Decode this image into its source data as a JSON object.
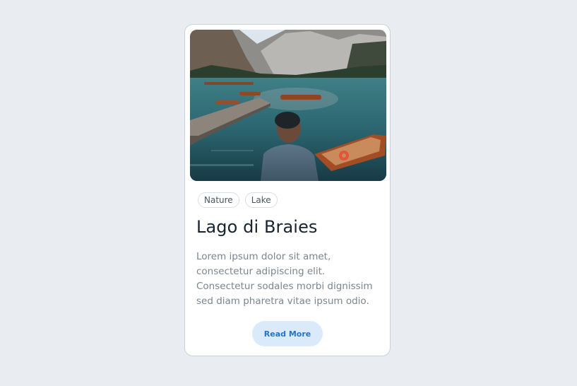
{
  "card": {
    "tags": [
      "Nature",
      "Lake"
    ],
    "title": "Lago di Braies",
    "description": "Lorem ipsum dolor sit amet, consectetur adipiscing elit. Consectetur sodales morbi dignissim sed diam pharetra vitae ipsum odio.",
    "button_label": "Read More"
  },
  "colors": {
    "page_background": "#e9edf1",
    "card_background": "#ffffff",
    "button_background": "#dbeafb",
    "button_text": "#2275c9",
    "title": "#17242f",
    "description": "#7a8590"
  }
}
